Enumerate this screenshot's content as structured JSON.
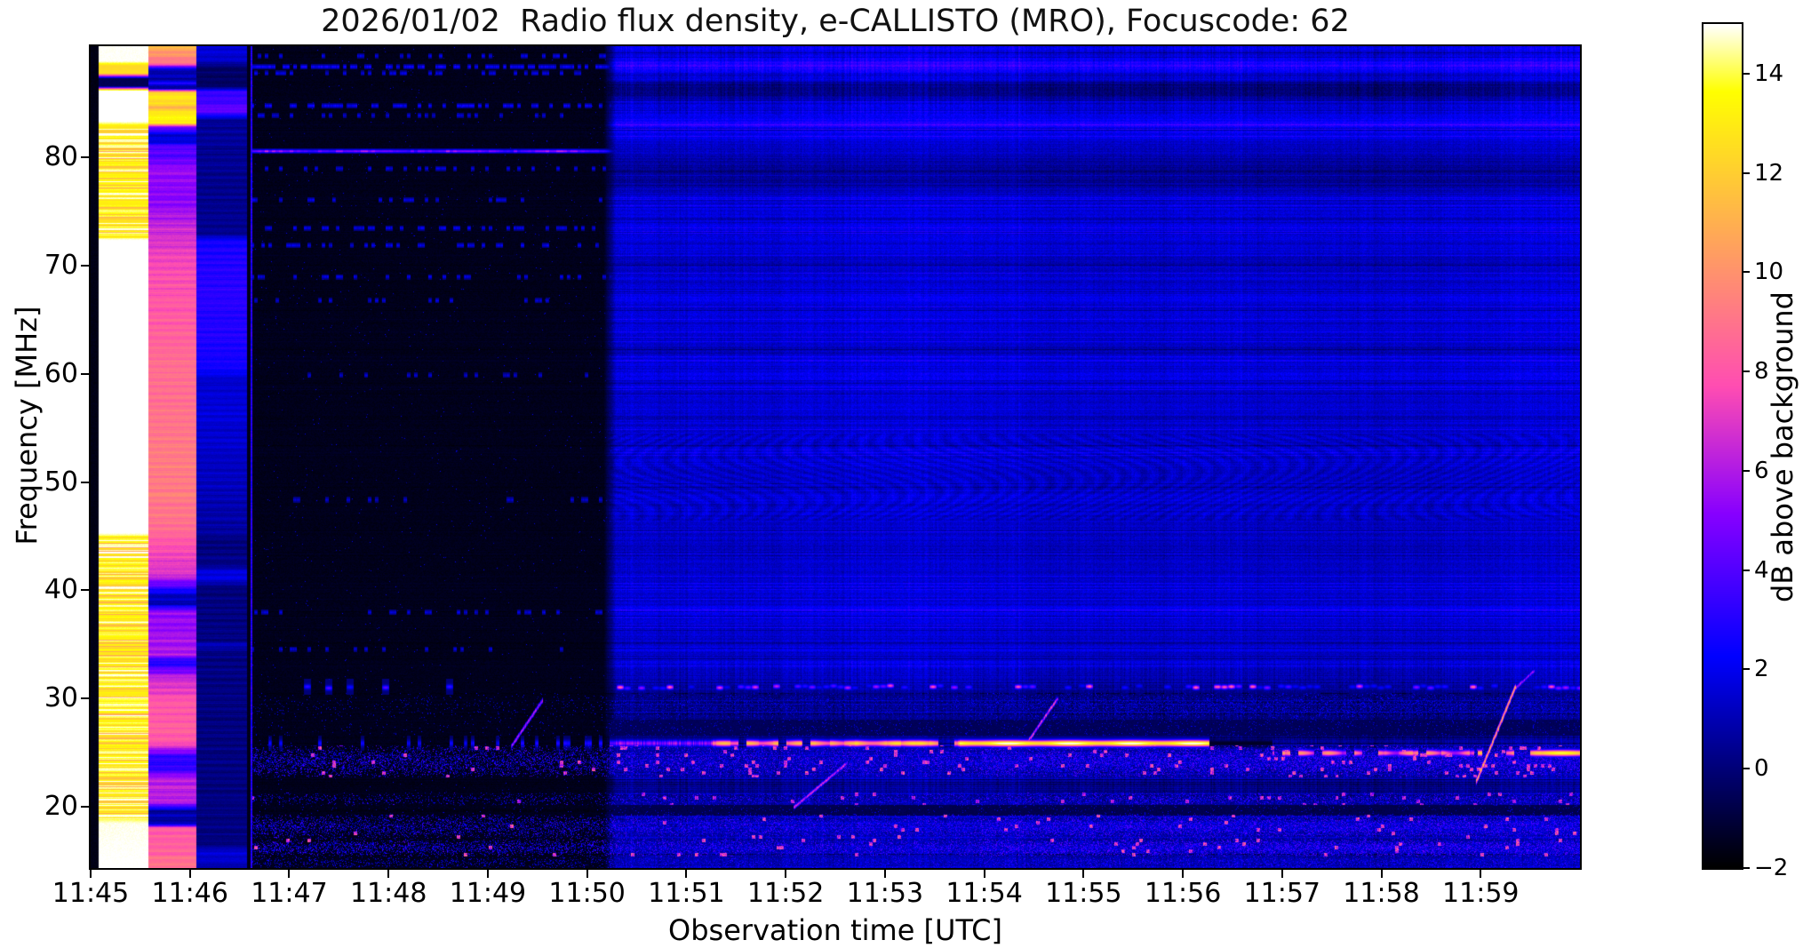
{
  "colors": {
    "background": "#ffffff",
    "text": "#000000",
    "spine": "#000000"
  },
  "chart_data": {
    "type": "heatmap",
    "subtype": "radio-spectrogram",
    "title": "2026/01/02  Radio flux density, e-CALLISTO (MRO), Focuscode: 62",
    "xlabel": "Observation time [UTC]",
    "ylabel": "Frequency [MHz]",
    "x_tick_labels": [
      "11:45",
      "11:46",
      "11:47",
      "11:48",
      "11:49",
      "11:50",
      "11:51",
      "11:52",
      "11:53",
      "11:54",
      "11:55",
      "11:56",
      "11:57",
      "11:58",
      "11:59"
    ],
    "y_tick_values": [
      80,
      70,
      60,
      50,
      40,
      30,
      20
    ],
    "freq_range_mhz": [
      14.34,
      90.26
    ],
    "time_start_utc": "11:45:00",
    "duration_s": 900,
    "grid": false,
    "colorbar": {
      "label": "dB above background",
      "vmin": -2,
      "vmax": 15,
      "colormap": "gnuplot2",
      "ticks": [
        {
          "v": 14,
          "label": "14"
        },
        {
          "v": 12,
          "label": "12"
        },
        {
          "v": 10,
          "label": "10"
        },
        {
          "v": 8,
          "label": "8"
        },
        {
          "v": 6,
          "label": "6"
        },
        {
          "v": 4,
          "label": "4"
        },
        {
          "v": 2,
          "label": "2"
        },
        {
          "v": 0,
          "label": "0"
        },
        {
          "v": -2,
          "label": "−2"
        }
      ]
    },
    "seed": 42,
    "time_segments": {
      "leading_black": {
        "t0": 0,
        "t1": 4.8,
        "db": -1.8
      },
      "saturated_band": {
        "t0": 4.8,
        "t1": 34.4
      },
      "pink_band": {
        "t0": 34.4,
        "t1": 63.9
      },
      "blue_band": {
        "t0": 63.9,
        "t1": 94.5
      },
      "black_gap": {
        "t0": 94.5,
        "t1": 96.4,
        "db": -1.7
      },
      "artifact_line": {
        "t0": 96.4,
        "t1": 97.7,
        "db": 2.4
      },
      "quiet_dark": {
        "t0": 97.7,
        "t1": 313.6
      },
      "active_blue": {
        "t0": 313.6,
        "t1": 900
      }
    },
    "profiles": {
      "band_white": {
        "stops": [
          [
            90.3,
            15.0
          ],
          [
            88.9,
            15.0
          ],
          [
            88.5,
            12.3
          ],
          [
            87.8,
            12.6
          ],
          [
            87.3,
            -0.6
          ],
          [
            86.6,
            -0.6
          ],
          [
            86.2,
            15.3
          ],
          [
            83.4,
            15.35
          ],
          [
            83.0,
            13.4
          ],
          [
            72.9,
            13.2
          ],
          [
            72.3,
            15.35
          ],
          [
            45.4,
            15.35
          ],
          [
            44.9,
            13.5
          ],
          [
            19.2,
            13.4
          ],
          [
            18.5,
            14.9
          ],
          [
            14.3,
            15.1
          ]
        ],
        "stripe_zones": [
          [
            83.2,
            72.6,
            1.7
          ],
          [
            45.2,
            18.8,
            1.7
          ]
        ]
      },
      "band_pink": {
        "stops": [
          [
            90.3,
            11.2
          ],
          [
            89.2,
            9.6
          ],
          [
            88.6,
            8.4
          ],
          [
            88.2,
            1.2
          ],
          [
            87.3,
            0.8
          ],
          [
            86.9,
            2.6
          ],
          [
            86.4,
            0.6
          ],
          [
            86.0,
            12.9
          ],
          [
            85.0,
            12.4
          ],
          [
            84.6,
            10.9
          ],
          [
            84.1,
            13.3
          ],
          [
            83.2,
            13.4
          ],
          [
            82.9,
            5.8
          ],
          [
            82.1,
            1.3
          ],
          [
            81.5,
            1.6
          ],
          [
            80.9,
            4.3
          ],
          [
            80.1,
            4.0
          ],
          [
            78.9,
            5.6
          ],
          [
            76.4,
            5.0
          ],
          [
            73.9,
            6.3
          ],
          [
            72.3,
            6.9
          ],
          [
            69.9,
            7.7
          ],
          [
            65.9,
            8.1
          ],
          [
            61.9,
            8.7
          ],
          [
            57.9,
            8.9
          ],
          [
            53.9,
            9.1
          ],
          [
            49.9,
            9.3
          ],
          [
            45.9,
            8.9
          ],
          [
            43.9,
            7.6
          ],
          [
            41.4,
            6.9
          ],
          [
            39.6,
            1.3
          ],
          [
            38.7,
            1.1
          ],
          [
            38.1,
            5.4
          ],
          [
            35.9,
            5.7
          ],
          [
            34.1,
            6.1
          ],
          [
            33.4,
            2.6
          ],
          [
            31.9,
            6.5
          ],
          [
            29.9,
            7.9
          ],
          [
            27.4,
            8.3
          ],
          [
            25.9,
            8.1
          ],
          [
            24.7,
            3.3
          ],
          [
            23.5,
            3.1
          ],
          [
            22.7,
            6.3
          ],
          [
            20.4,
            6.1
          ],
          [
            19.7,
            0.9
          ],
          [
            18.5,
            0.7
          ],
          [
            18.1,
            8.1
          ],
          [
            15.9,
            8.4
          ],
          [
            14.3,
            9.1
          ]
        ],
        "stripe_amp": 0.7
      },
      "band_blue": {
        "stops": [
          [
            90.3,
            1.7
          ],
          [
            88.9,
            1.4
          ],
          [
            88.4,
            -0.3
          ],
          [
            86.6,
            -0.5
          ],
          [
            86.1,
            3.4
          ],
          [
            84.9,
            3.6
          ],
          [
            84.5,
            4.7
          ],
          [
            84.0,
            3.2
          ],
          [
            83.5,
            0.5
          ],
          [
            76.0,
            0.3
          ],
          [
            72.9,
            0.4
          ],
          [
            72.3,
            2.7
          ],
          [
            67.9,
            3.1
          ],
          [
            63.9,
            2.9
          ],
          [
            60.4,
            2.5
          ],
          [
            59.7,
            1.5
          ],
          [
            55.9,
            1.6
          ],
          [
            51.9,
            1.3
          ],
          [
            47.9,
            0.9
          ],
          [
            45.4,
            0.6
          ],
          [
            44.7,
            0.1
          ],
          [
            42.3,
            0.2
          ],
          [
            41.7,
            1.9
          ],
          [
            41.0,
            1.7
          ],
          [
            40.4,
            0.15
          ],
          [
            35.4,
            0.1
          ],
          [
            34.9,
            1.3
          ],
          [
            34.4,
            0.12
          ],
          [
            16.6,
            0.1
          ],
          [
            15.9,
            1.5
          ],
          [
            14.8,
            1.3
          ],
          [
            14.3,
            0.4
          ]
        ],
        "stripe_amp": 0.5
      },
      "active_base": {
        "stops": [
          [
            90.3,
            2.0
          ],
          [
            88.9,
            1.6
          ],
          [
            87.8,
            1.5
          ],
          [
            85.9,
            1.3
          ],
          [
            84.3,
            1.9
          ],
          [
            82.6,
            1.5
          ],
          [
            80.4,
            1.3
          ],
          [
            76.9,
            1.55
          ],
          [
            73.9,
            1.7
          ],
          [
            70.9,
            1.55
          ],
          [
            67.9,
            1.6
          ],
          [
            63.9,
            1.5
          ],
          [
            59.9,
            1.55
          ],
          [
            55.9,
            1.45
          ],
          [
            51.9,
            1.5
          ],
          [
            47.9,
            1.45
          ],
          [
            43.9,
            1.4
          ],
          [
            39.9,
            1.45
          ],
          [
            35.9,
            1.35
          ],
          [
            33.4,
            1.15
          ],
          [
            31.6,
            0.9
          ],
          [
            30.6,
            0.6
          ],
          [
            28.2,
            0.2
          ],
          [
            26.7,
            0.35
          ],
          [
            25.6,
            0.55
          ],
          [
            22.9,
            0.6
          ],
          [
            21.4,
            0.35
          ],
          [
            19.4,
            0.5
          ],
          [
            17.1,
            0.6
          ],
          [
            14.3,
            0.65
          ]
        ]
      }
    },
    "quiet_region": {
      "base_db": -1.55,
      "noise_db": 0.4,
      "dot_density": 0.0035,
      "spectral_lines": [
        {
          "f": 89.4,
          "d": 0.25,
          "v": 1.8
        },
        {
          "f": 88.4,
          "d": 0.55,
          "v": 2.4
        },
        {
          "f": 87.8,
          "d": 0.3,
          "v": 1.8
        },
        {
          "f": 84.8,
          "d": 0.45,
          "v": 2.2
        },
        {
          "f": 83.9,
          "d": 0.2,
          "v": 1.6
        },
        {
          "f": 80.6,
          "solid": true,
          "v": 4.2,
          "var": 2.3
        },
        {
          "f": 79.0,
          "d": 0.22,
          "v": 1.7
        },
        {
          "f": 76.1,
          "d": 0.22,
          "v": 1.7
        },
        {
          "f": 73.5,
          "d": 0.3,
          "v": 1.9
        },
        {
          "f": 71.9,
          "d": 0.3,
          "v": 1.8
        },
        {
          "f": 69.0,
          "d": 0.28,
          "v": 1.8
        },
        {
          "f": 66.8,
          "d": 0.15,
          "v": 1.5
        },
        {
          "f": 59.9,
          "d": 0.12,
          "v": 1.4
        },
        {
          "f": 48.4,
          "d": 0.12,
          "v": 1.4
        },
        {
          "f": 38.0,
          "d": 0.2,
          "v": 1.6
        },
        {
          "f": 34.6,
          "d": 0.15,
          "v": 1.5
        }
      ]
    },
    "active_region": {
      "bright_rows": [
        {
          "f": 88.5,
          "a": 1.5,
          "w": 0.4
        },
        {
          "f": 87.2,
          "a": 0.7,
          "w": 0.25
        },
        {
          "f": 83.1,
          "a": 1.25,
          "w": 0.35
        },
        {
          "f": 81.9,
          "a": 0.5,
          "w": 0.25
        },
        {
          "f": 67.0,
          "a": 0.5,
          "w": 0.3
        },
        {
          "f": 59.8,
          "a": 0.4,
          "w": 0.3
        },
        {
          "f": 48.5,
          "a": 0.4,
          "w": 0.3
        },
        {
          "f": 38.1,
          "a": 0.85,
          "w": 0.3
        },
        {
          "f": 34.7,
          "a": 0.6,
          "w": 0.28
        },
        {
          "f": 33.3,
          "a": 0.5,
          "w": 0.22
        }
      ],
      "dark_rows": [
        {
          "f": 86.3,
          "a": -1.2,
          "w": 0.8
        },
        {
          "f": 78.4,
          "a": -1.1,
          "w": 1.1
        },
        {
          "f": 70.3,
          "a": -0.5,
          "w": 0.5
        },
        {
          "f": 62.4,
          "a": -0.35,
          "w": 0.5
        },
        {
          "f": 44.2,
          "a": -0.3,
          "w": 0.6
        },
        {
          "f": 29.9,
          "a": -0.5,
          "w": 0.6
        }
      ],
      "moire": {
        "f_hi": 54.5,
        "f_lo": 46.5,
        "amp": 0.35
      }
    },
    "blob_line": {
      "f": 31.1,
      "density": 0.55,
      "pink_fraction": 0.12,
      "v_max": 8.2,
      "d_factor": 0.2
    },
    "orange_line": {
      "f_early": 25.9,
      "f_late": 25.0,
      "segments": [
        {
          "t0": 98,
          "t1": 258,
          "mode": "dots",
          "p": 0.15,
          "v0": 1.0,
          "v1": 2.6
        },
        {
          "t0": 258,
          "t1": 314,
          "mode": "dots",
          "p": 0.3,
          "v0": 1.5,
          "v1": 4.2
        },
        {
          "t0": 314,
          "t1": 376,
          "mode": "speck",
          "p": 0,
          "v0": 3.0,
          "v1": 6.0
        },
        {
          "t0": 376,
          "t1": 462,
          "mode": "seg",
          "p": 0.25,
          "v0": 7.0,
          "v1": 10.5
        },
        {
          "t0": 462,
          "t1": 525,
          "mode": "seg",
          "p": 0.15,
          "v0": 8.0,
          "v1": 11.5
        },
        {
          "t0": 525,
          "t1": 676,
          "mode": "solid",
          "p": 0,
          "v0": 11.0,
          "v1": 13.8
        },
        {
          "t0": 676,
          "t1": 714,
          "mode": "black",
          "p": 0,
          "v0": -1.3,
          "v1": -1.3
        },
        {
          "t0": 714,
          "t1": 838,
          "mode": "seg",
          "p": 0.35,
          "v0": 5.0,
          "v1": 9.5
        },
        {
          "t0": 838,
          "t1": 877,
          "mode": "seg",
          "p": 0.2,
          "v0": 7.0,
          "v1": 11.0
        },
        {
          "t0": 877,
          "t1": 900,
          "mode": "solid",
          "p": 0,
          "v0": 9.5,
          "v1": 12.5
        }
      ]
    },
    "rfi_bands": [
      {
        "f_hi": 30.5,
        "f_lo": 28.2,
        "type": "speckle",
        "density": 0.22,
        "v0": 0.3,
        "v1": 2.6,
        "d_factor": 0.2
      },
      {
        "f_hi": 28.0,
        "f_lo": 26.7,
        "type": "dark",
        "base": -0.5,
        "dots": 0.05
      },
      {
        "f_hi": 25.6,
        "f_lo": 22.8,
        "type": "speckle",
        "density": 0.6,
        "v0": 0.4,
        "v1": 4.2,
        "blob_p": 0.045,
        "blob_v": 8.3,
        "d_factor": 0.55
      },
      {
        "f_hi": 21.3,
        "f_lo": 20.2,
        "type": "speckle",
        "density": 0.4,
        "v0": 0.4,
        "v1": 3.8,
        "blob_p": 0.03,
        "blob_v": 7.5,
        "d_factor": 0.35
      },
      {
        "f_hi": 20.1,
        "f_lo": 19.3,
        "type": "dark",
        "base": -0.7,
        "dots": 0.04
      },
      {
        "f_hi": 19.2,
        "f_lo": 17.2,
        "type": "speckle",
        "density": 0.65,
        "v0": 0.4,
        "v1": 4.0,
        "blob_p": 0.02,
        "blob_v": 8.5,
        "d_factor": 0.5
      },
      {
        "f_hi": 17.0,
        "f_lo": 15.5,
        "type": "speckle",
        "density": 0.7,
        "v0": 0.4,
        "v1": 4.2,
        "blob_p": 0.02,
        "blob_v": 8.5,
        "d_factor": 0.5
      },
      {
        "f_hi": 15.4,
        "f_lo": 14.34,
        "type": "speckle",
        "density": 0.45,
        "v0": 0.3,
        "v1": 3.2,
        "d_factor": 0.4
      }
    ],
    "sweeps": [
      {
        "t0": 254,
        "f0": 25.6,
        "t1": 273,
        "f1": 29.9,
        "db": 5.5,
        "w": 2
      },
      {
        "t0": 425,
        "f0": 20.0,
        "t1": 457,
        "f1": 24.1,
        "db": 6.0,
        "w": 2
      },
      {
        "t0": 565,
        "f0": 25.8,
        "t1": 584,
        "f1": 30.0,
        "db": 6.5,
        "w": 2
      },
      {
        "t0": 837,
        "f0": 22.3,
        "t1": 861,
        "f1": 31.2,
        "db": 9.0,
        "w": 3
      },
      {
        "t0": 859,
        "f0": 30.7,
        "t1": 872,
        "f1": 32.6,
        "db": 5.0,
        "w": 2
      }
    ]
  }
}
